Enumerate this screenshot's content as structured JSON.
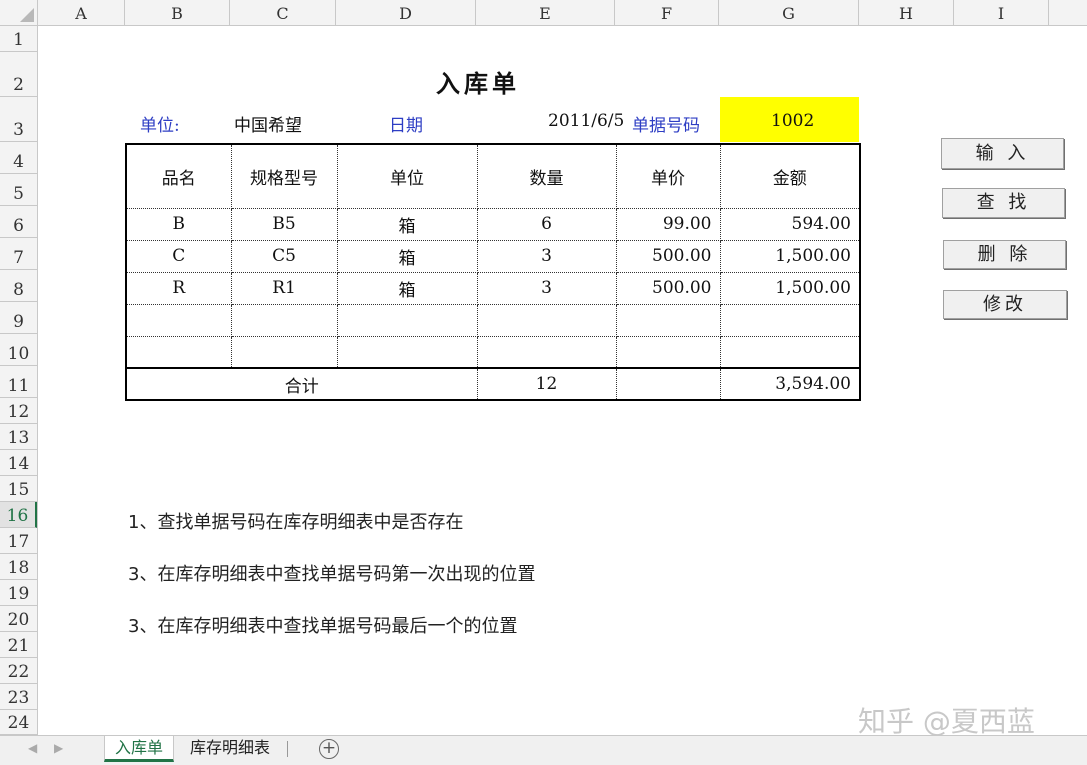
{
  "columns": [
    "A",
    "B",
    "C",
    "D",
    "E",
    "F",
    "G",
    "H",
    "I"
  ],
  "rows": [
    "1",
    "2",
    "3",
    "4",
    "5",
    "6",
    "7",
    "8",
    "9",
    "10",
    "11",
    "12",
    "13",
    "14",
    "15",
    "16",
    "17",
    "18",
    "19",
    "20",
    "21",
    "22",
    "23",
    "24"
  ],
  "active_row": "16",
  "form": {
    "title": "入库单",
    "unit_label": "单位:",
    "unit_value": "中国希望",
    "date_label": "日期",
    "date_value": "2011/6/5",
    "docno_label": "单据号码",
    "docno_value": "1002"
  },
  "table": {
    "headers": [
      "品名",
      "规格型号",
      "单位",
      "数量",
      "单价",
      "金额"
    ],
    "rows": [
      [
        "B",
        "B5",
        "箱",
        "6",
        "99.00",
        "594.00"
      ],
      [
        "C",
        "C5",
        "箱",
        "3",
        "500.00",
        "1,500.00"
      ],
      [
        "R",
        "R1",
        "箱",
        "3",
        "500.00",
        "1,500.00"
      ],
      [
        "",
        "",
        "",
        "",
        "",
        ""
      ],
      [
        "",
        "",
        "",
        "",
        "",
        ""
      ]
    ],
    "total_label": "合计",
    "total_qty": "12",
    "total_amount": "3,594.00"
  },
  "buttons": {
    "input": "输 入",
    "find": "查 找",
    "delete": "删 除",
    "modify": "修改"
  },
  "notes": [
    "1、查找单据号码在库存明细表中是否存在",
    "3、在库存明细表中查找单据号码第一次出现的位置",
    "3、在库存明细表中查找单据号码最后一个的位置"
  ],
  "watermark": "知乎 @夏西蓝",
  "sheets": {
    "active": "入库单",
    "other": "库存明细表",
    "add": "+"
  },
  "colors": {
    "accent": "#217346",
    "label_blue": "#2e3ec4",
    "highlight": "#ffff00"
  }
}
